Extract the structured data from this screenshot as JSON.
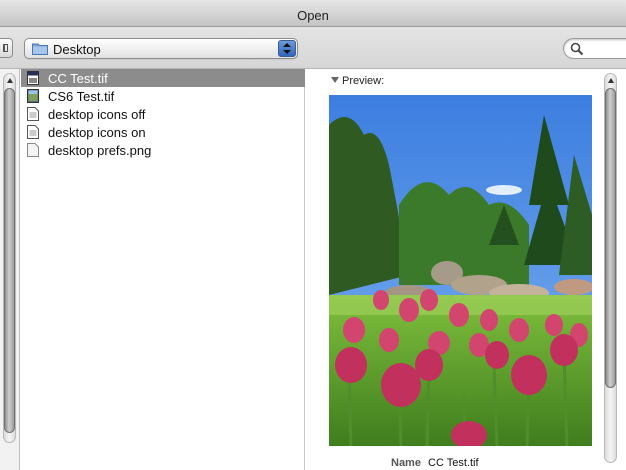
{
  "window": {
    "title": "Open"
  },
  "toolbar": {
    "location": "Desktop",
    "search_placeholder": ""
  },
  "files": [
    {
      "name": "CC Test.tif",
      "icon": "tif-file-icon",
      "selected": true
    },
    {
      "name": "CS6 Test.tif",
      "icon": "image-file-icon",
      "selected": false
    },
    {
      "name": "desktop icons off",
      "icon": "document-icon",
      "selected": false
    },
    {
      "name": "desktop icons on",
      "icon": "document-icon",
      "selected": false
    },
    {
      "name": "desktop prefs.png",
      "icon": "plain-file-icon",
      "selected": false
    }
  ],
  "preview": {
    "label": "Preview:",
    "name_key": "Name",
    "name_value": "CC Test.tif"
  },
  "colors": {
    "selection": "#8c8c8c",
    "stepper": "#3b70c8"
  }
}
